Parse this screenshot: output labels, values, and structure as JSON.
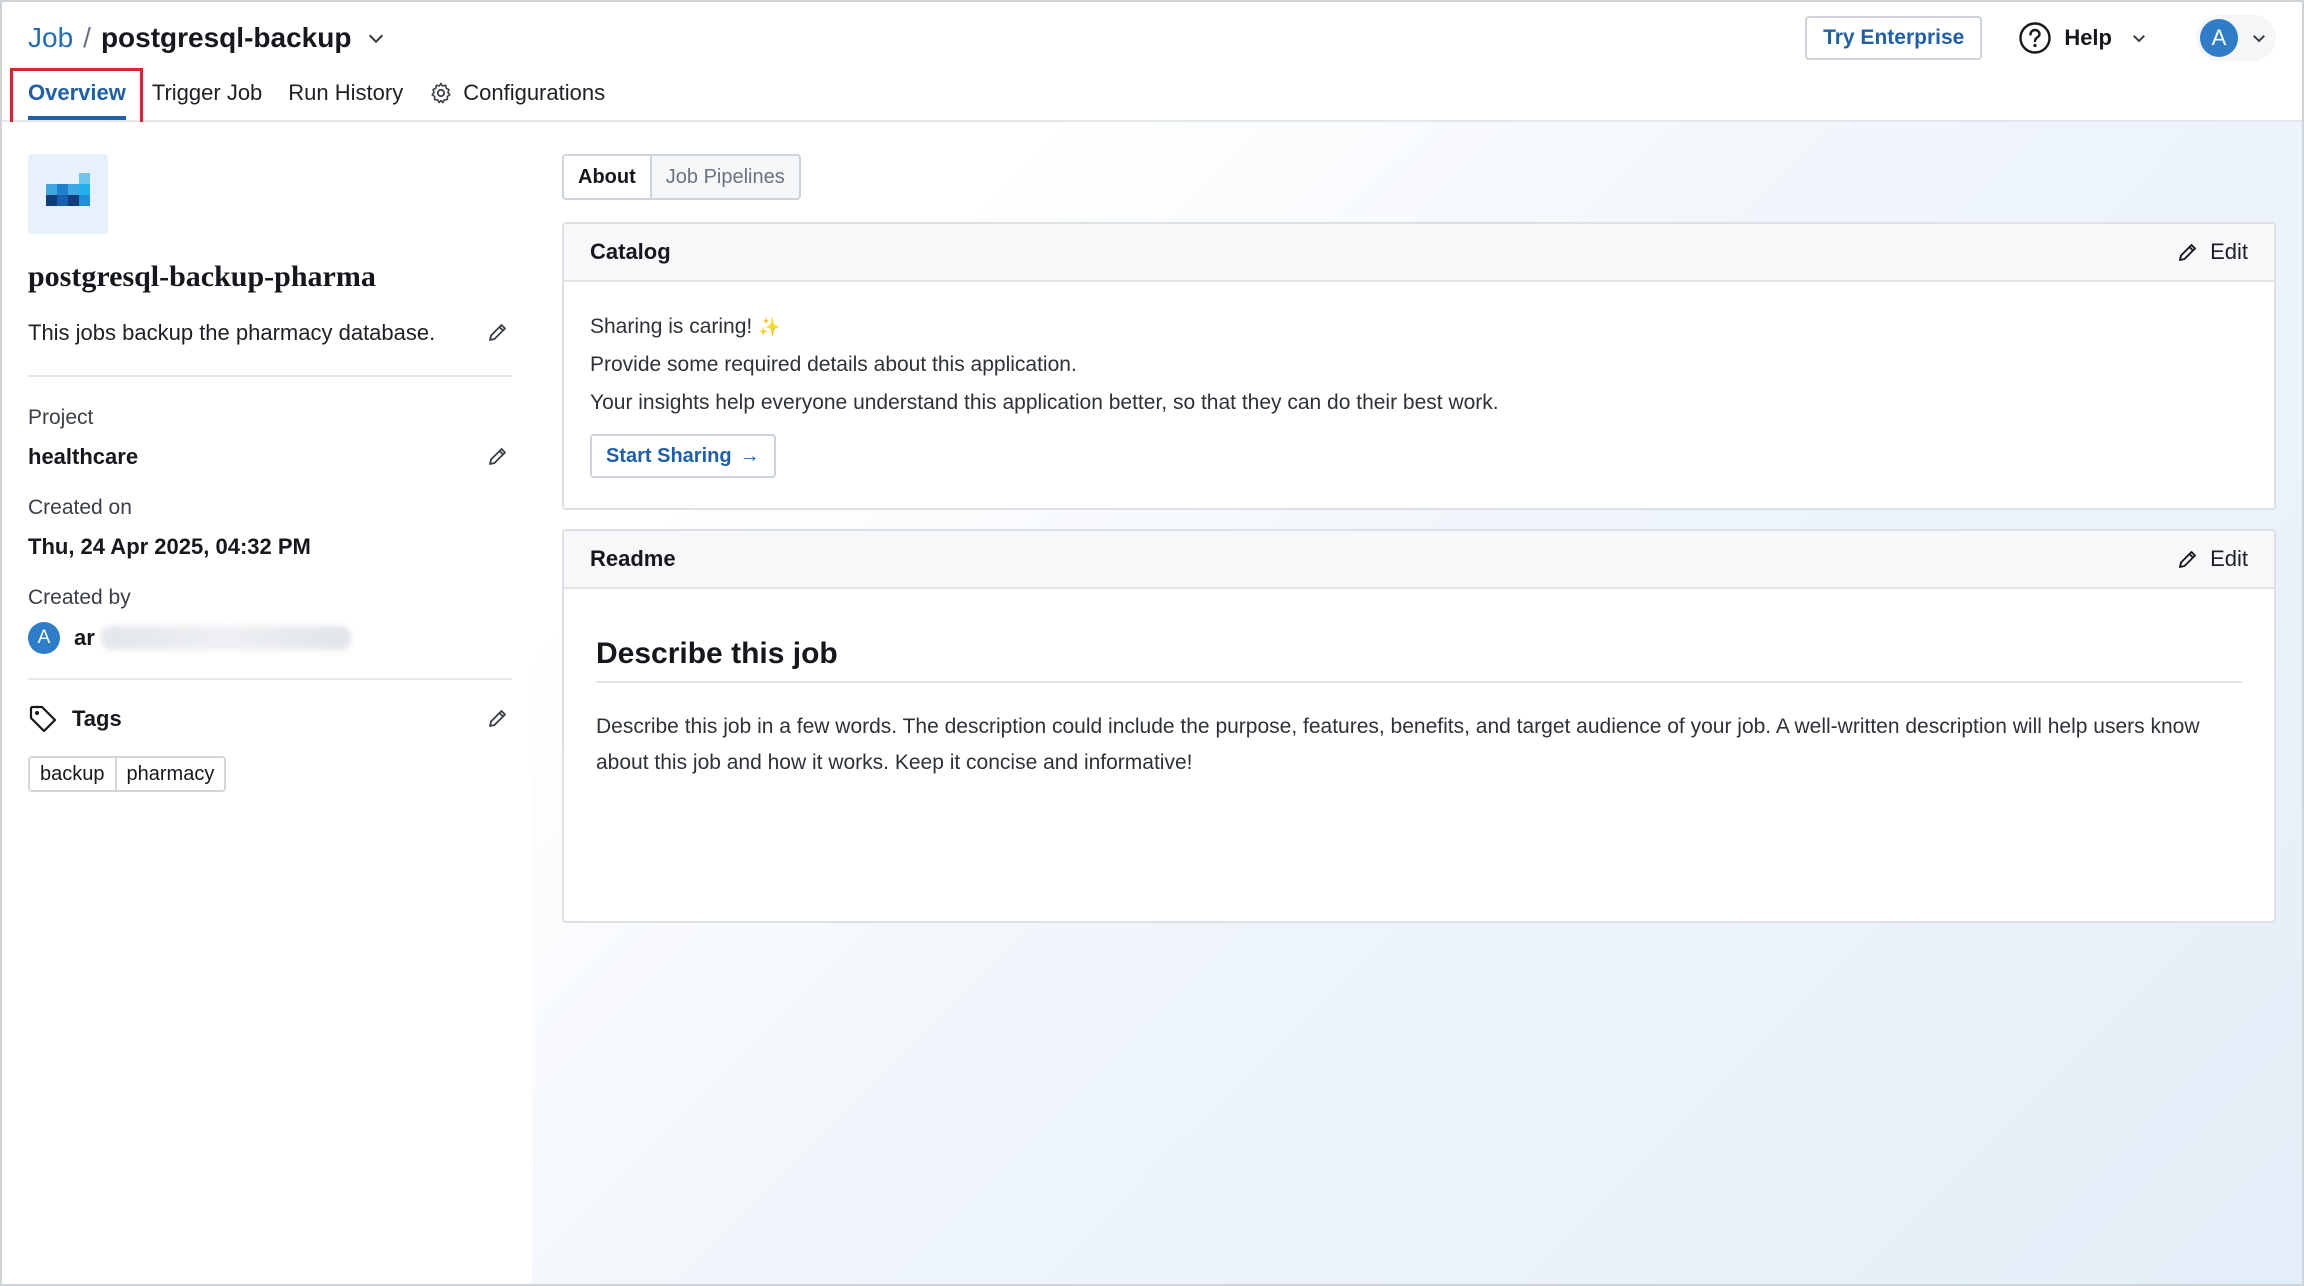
{
  "header": {
    "breadcrumb_root": "Job",
    "breadcrumb_sep": "/",
    "breadcrumb_current": "postgresql-backup",
    "try_enterprise": "Try Enterprise",
    "help": "Help",
    "avatar_initial": "A"
  },
  "tabs": [
    {
      "label": "Overview",
      "active": true
    },
    {
      "label": "Trigger Job"
    },
    {
      "label": "Run History"
    },
    {
      "label": "Configurations"
    }
  ],
  "sidebar": {
    "job_name": "postgresql-backup-pharma",
    "description": "This jobs backup the pharmacy database.",
    "project_label": "Project",
    "project_value": "healthcare",
    "created_on_label": "Created on",
    "created_on_value": "Thu, 24 Apr 2025, 04:32 PM",
    "created_by_label": "Created by",
    "creator_initial": "A",
    "creator_visible": "ar",
    "tags_label": "Tags",
    "tags": [
      "backup",
      "pharmacy"
    ]
  },
  "main": {
    "subtabs": [
      {
        "label": "About",
        "active": true
      },
      {
        "label": "Job Pipelines"
      }
    ],
    "catalog": {
      "title": "Catalog",
      "edit": "Edit",
      "line1": "Sharing is caring!",
      "sparkle": "✨",
      "line2": "Provide some required details about this application.",
      "line3": "Your insights help everyone understand this application better, so that they can do their best work.",
      "button": "Start Sharing",
      "button_arrow": "→"
    },
    "readme": {
      "title": "Readme",
      "edit": "Edit",
      "heading": "Describe this job",
      "body": "Describe this job in a few words. The description could include the purpose, features, benefits, and target audience of your job. A well-written description will help users know about this job and how it works. Keep it concise and informative!"
    }
  },
  "colors": {
    "accent": "#1f5fa8",
    "highlight": "#d62828",
    "avatar": "#2f7cc9"
  }
}
